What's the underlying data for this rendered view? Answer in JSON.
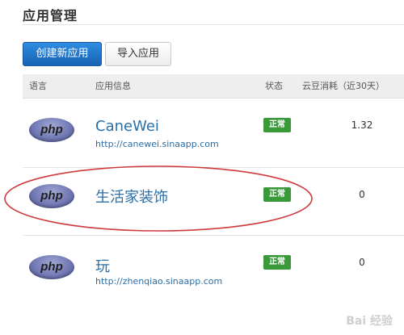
{
  "page": {
    "title": "应用管理"
  },
  "toolbar": {
    "create_label": "创建新应用",
    "import_label": "导入应用"
  },
  "table": {
    "columns": {
      "language": "语言",
      "info": "应用信息",
      "status": "状态",
      "quota": "云豆消耗（近30天）"
    },
    "rows": [
      {
        "language": "php",
        "name": "CaneWei",
        "url": "http://canewei.sinaapp.com",
        "status": "正常",
        "quota": "1.32"
      },
      {
        "language": "php",
        "name": "生活家装饰",
        "url": "",
        "status": "正常",
        "quota": "0"
      },
      {
        "language": "php",
        "name": "玩",
        "url": "http://zhenqiao.sinaapp.com",
        "status": "正常",
        "quota": "0"
      }
    ]
  },
  "annotation": {
    "color": "#d0393c",
    "highlighted_row": 1
  },
  "colors": {
    "primary": "#1762b4",
    "link": "#2b6ea8",
    "status_ok": "#3a9a3a"
  }
}
